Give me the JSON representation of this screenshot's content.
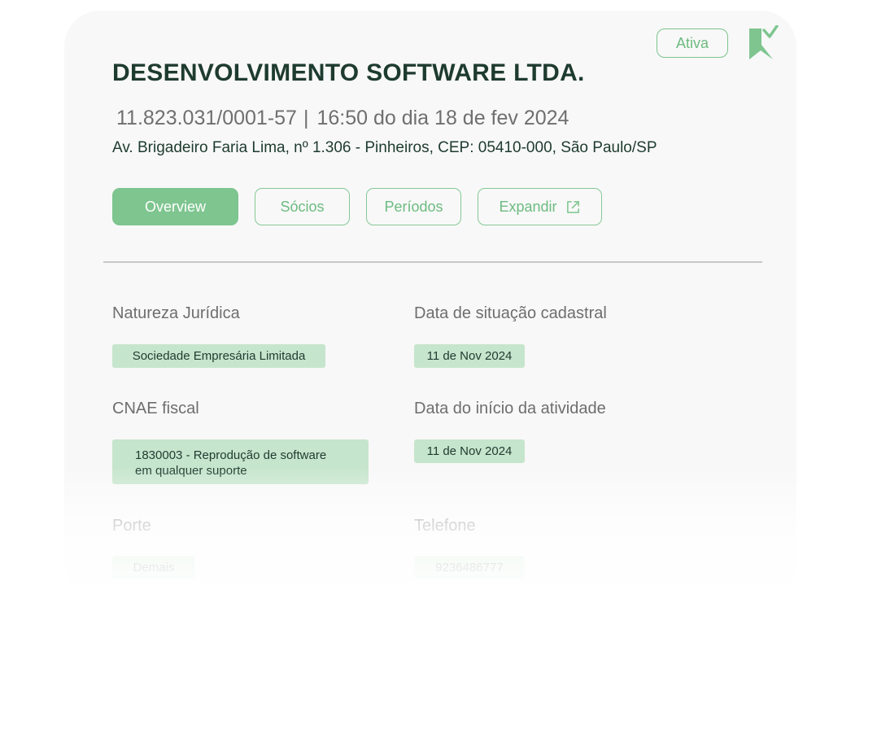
{
  "company": {
    "status": "Ativa",
    "name": "DESENVOLVIMENTO SOFTWARE LTDA.",
    "cnpj": "11.823.031/0001-57",
    "separator": "|",
    "datetime": "16:50 do dia 18 de fev 2024",
    "address": "Av. Brigadeiro Faria Lima, nº 1.306 - Pinheiros, CEP: 05410-000, São Paulo/SP"
  },
  "logo": {
    "icon": "checkmark-flag-logo",
    "color": "#7ec58f"
  },
  "tabs": [
    {
      "label": "Overview",
      "active": true
    },
    {
      "label": "Sócios",
      "active": false
    },
    {
      "label": "Períodos",
      "active": false
    },
    {
      "label": "Expandir",
      "active": false,
      "icon": "external-link-icon"
    }
  ],
  "fields": {
    "natureza": {
      "label": "Natureza Jurídica",
      "value": "Sociedade Empresária Limitada"
    },
    "situacao": {
      "label": "Data de situação cadastral",
      "value": "11 de Nov 2024"
    },
    "cnae": {
      "label": "CNAE fiscal",
      "value_line1": "1830003 - Reprodução de software",
      "value_line2": "em qualquer suporte"
    },
    "inicio": {
      "label": "Data do início da atividade",
      "value": "11 de Nov 2024"
    },
    "porte": {
      "label": "Porte",
      "value": "Demais"
    },
    "telefone": {
      "label": "Telefone",
      "value": "9236486777"
    }
  },
  "colors": {
    "accent": "#7ec58f",
    "chip_background": "#c6e5cd",
    "title": "#1e3b2f",
    "muted_text": "#6e6e6e"
  }
}
